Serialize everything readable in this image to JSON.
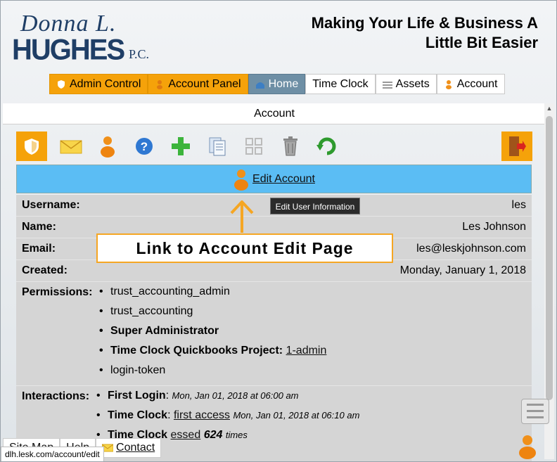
{
  "header": {
    "logo_script": "Donna L.",
    "logo_name": "HUGHES",
    "logo_suffix": "P.C.",
    "tagline_line1": "Making Your Life & Business A",
    "tagline_line2": "Little Bit Easier"
  },
  "nav": {
    "items": [
      {
        "label": "Admin Control",
        "icon": "shield-icon"
      },
      {
        "label": "Account Panel",
        "icon": "person-icon"
      },
      {
        "label": "Home",
        "icon": "home-icon"
      },
      {
        "label": "Time Clock",
        "icon": ""
      },
      {
        "label": "Assets",
        "icon": "list-icon"
      },
      {
        "label": "Account",
        "icon": "person-icon"
      }
    ]
  },
  "page": {
    "title": "Account"
  },
  "toolbar": {
    "icons": [
      "shield-icon",
      "mail-icon",
      "person-icon",
      "help-icon",
      "add-icon",
      "documents-icon",
      "expand-icon",
      "trash-icon",
      "refresh-icon",
      "exit-icon"
    ]
  },
  "edit": {
    "link": "Edit Account",
    "tooltip": "Edit User Information"
  },
  "callout": {
    "text": "Link to Account Edit Page"
  },
  "account": {
    "username_label": "Username:",
    "username": "les",
    "name_label": "Name:",
    "name": "Les Johnson",
    "email_label": "Email:",
    "email": "les@leskjohnson.com",
    "created_label": "Created:",
    "created": "Monday, January 1, 2018",
    "permissions_label": "Permissions:",
    "permissions": [
      "trust_accounting_admin",
      "trust_accounting",
      "Super Administrator",
      "Time Clock Quickbooks Project:",
      "login-token"
    ],
    "project_link": "1-admin",
    "interactions_label": "Interactions:",
    "first_login_label": "First Login",
    "first_login_time": "Mon, Jan 01, 2018 at 06:00 am",
    "time_clock_label": "Time Clock",
    "time_clock_link": "first access",
    "time_clock_time": "Mon, Jan 01, 2018 at 06:10 am",
    "time_clock2_label": "Time Clock",
    "accessed_text": "essed",
    "accessed_count": "624",
    "accessed_suffix": "times"
  },
  "footer": {
    "sitemap": "Site Map",
    "help": "Help",
    "contact": "Contact"
  },
  "status_url": "dlh.lesk.com/account/edit",
  "colors": {
    "accent": "#f5a20a",
    "edit_bar": "#5bbdf4",
    "nav_home": "#6e8fa5",
    "brand": "#1f3e66"
  }
}
